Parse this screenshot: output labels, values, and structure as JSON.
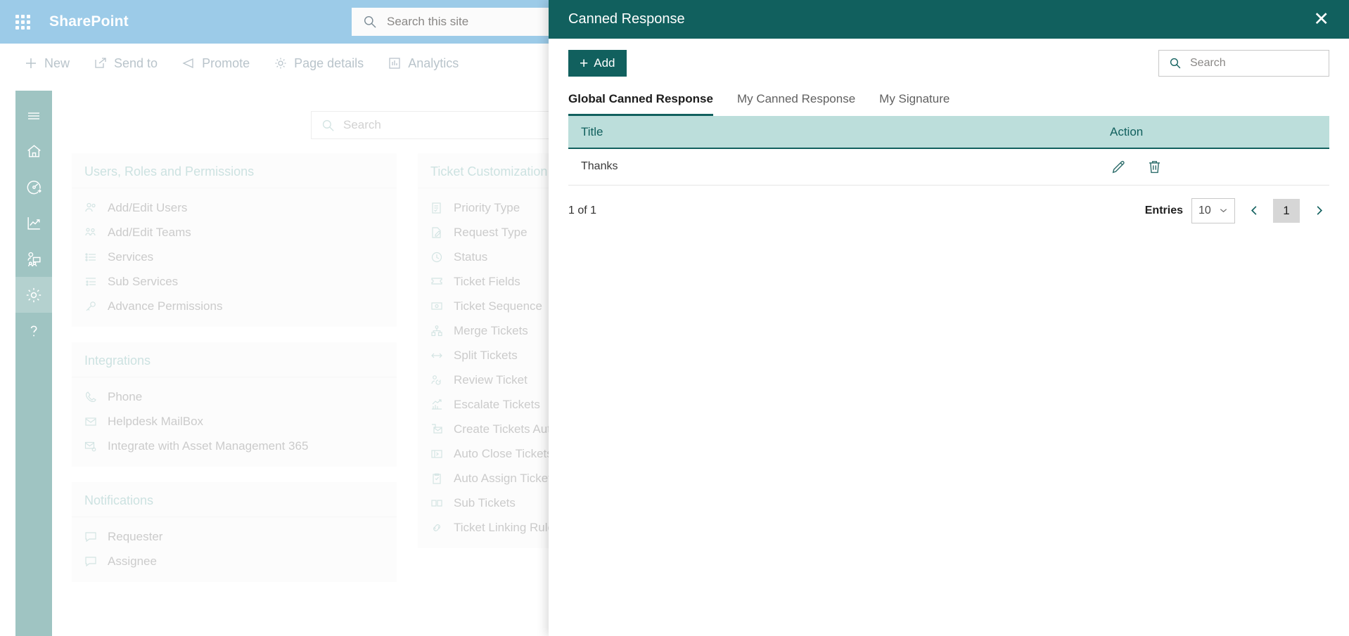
{
  "suite": {
    "brand": "SharePoint",
    "search_placeholder": "Search this site"
  },
  "command_bar": {
    "items": [
      {
        "label": "New",
        "icon": "plus-icon"
      },
      {
        "label": "Send to",
        "icon": "send-to-icon"
      },
      {
        "label": "Promote",
        "icon": "promote-icon"
      },
      {
        "label": "Page details",
        "icon": "gear-icon"
      },
      {
        "label": "Analytics",
        "icon": "analytics-icon"
      }
    ]
  },
  "rail": {
    "items": [
      {
        "name": "menu",
        "icon": "hamburger-icon",
        "active": false
      },
      {
        "name": "home",
        "icon": "home-icon",
        "active": false
      },
      {
        "name": "dashboard",
        "icon": "speedometer-icon",
        "active": false
      },
      {
        "name": "reports",
        "icon": "trend-chart-icon",
        "active": false
      },
      {
        "name": "teams",
        "icon": "people-presentation-icon",
        "active": false
      },
      {
        "name": "settings",
        "icon": "gear-icon",
        "active": true
      },
      {
        "name": "help",
        "icon": "question-mark-icon",
        "active": false
      }
    ]
  },
  "page": {
    "search_placeholder": "Search",
    "columns": [
      {
        "cards": [
          {
            "title": "Users, Roles and Permissions",
            "rows": [
              {
                "label": "Add/Edit Users",
                "icon": "users-icon"
              },
              {
                "label": "Add/Edit Teams",
                "icon": "teams-icon"
              },
              {
                "label": "Services",
                "icon": "list-icon"
              },
              {
                "label": "Sub Services",
                "icon": "sub-list-icon"
              },
              {
                "label": "Advance Permissions",
                "icon": "key-icon"
              }
            ]
          },
          {
            "title": "Integrations",
            "rows": [
              {
                "label": "Phone",
                "icon": "phone-icon"
              },
              {
                "label": "Helpdesk MailBox",
                "icon": "mail-icon"
              },
              {
                "label": "Integrate with Asset Management 365",
                "icon": "mail-gear-icon"
              }
            ]
          },
          {
            "title": "Notifications",
            "rows": [
              {
                "label": "Requester",
                "icon": "comment-icon"
              },
              {
                "label": "Assignee",
                "icon": "comment-icon"
              }
            ]
          }
        ]
      },
      {
        "cards": [
          {
            "title": "Ticket Customization",
            "rows": [
              {
                "label": "Priority Type",
                "icon": "priority-icon"
              },
              {
                "label": "Request Type",
                "icon": "request-icon"
              },
              {
                "label": "Status",
                "icon": "clock-check-icon"
              },
              {
                "label": "Ticket Fields",
                "icon": "ticket-icon"
              },
              {
                "label": "Ticket Sequence",
                "icon": "ticket-sequence-icon"
              },
              {
                "label": "Merge Tickets",
                "icon": "merge-icon"
              },
              {
                "label": "Split Tickets",
                "icon": "split-icon"
              },
              {
                "label": "Review Ticket",
                "icon": "review-icon"
              },
              {
                "label": "Escalate Tickets",
                "icon": "escalate-icon"
              },
              {
                "label": "Create Tickets Automatically",
                "icon": "auto-create-icon"
              },
              {
                "label": "Auto Close Tickets",
                "icon": "auto-close-icon"
              },
              {
                "label": "Auto Assign Tickets",
                "icon": "auto-assign-icon"
              },
              {
                "label": "Sub Tickets",
                "icon": "sub-ticket-icon"
              },
              {
                "label": "Ticket Linking Rules",
                "icon": "link-icon"
              }
            ]
          }
        ]
      }
    ]
  },
  "panel": {
    "title": "Canned Response",
    "close_label": "✕",
    "add_label": "Add",
    "add_icon": "plus-icon",
    "search_placeholder": "Search",
    "tabs": [
      {
        "label": "Global Canned Response",
        "active": true
      },
      {
        "label": "My Canned Response",
        "active": false
      },
      {
        "label": "My Signature",
        "active": false
      }
    ],
    "table": {
      "headers": [
        "Title",
        "Action"
      ],
      "rows": [
        {
          "title": "Thanks",
          "actions": [
            "edit-icon",
            "delete-icon"
          ]
        }
      ]
    },
    "pager": {
      "summary": "1 of 1",
      "entries_label": "Entries",
      "entries_value": "10",
      "prev_label": "‹",
      "next_label": "›",
      "current_page": "1"
    }
  },
  "colors": {
    "suite_bar": "#9ccbe8",
    "panel_header": "#11605e",
    "accent_teal": "#11605e",
    "table_header_bg": "#bcdedb",
    "rail_bg": "#9fc4c2",
    "rail_active": "#b4d1cf"
  }
}
